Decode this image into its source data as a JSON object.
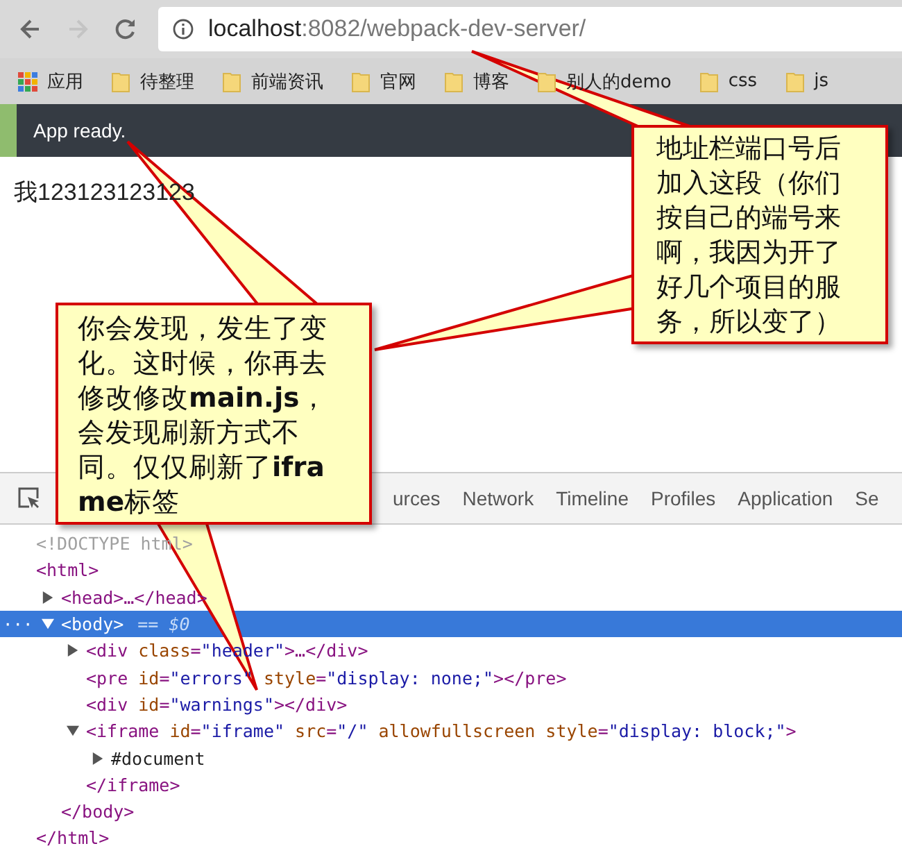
{
  "browser": {
    "address_host": "localhost",
    "address_path": ":8082/webpack-dev-server/",
    "forward_disabled": true
  },
  "bookmarks": [
    {
      "kind": "apps",
      "label": "应用"
    },
    {
      "kind": "folder",
      "label": "待整理"
    },
    {
      "kind": "folder",
      "label": "前端资讯"
    },
    {
      "kind": "folder",
      "label": "官网"
    },
    {
      "kind": "folder",
      "label": "博客"
    },
    {
      "kind": "folder",
      "label": "别人的demo"
    },
    {
      "kind": "folder",
      "label": "css"
    },
    {
      "kind": "folder",
      "label": "js"
    }
  ],
  "page": {
    "status": "App ready.",
    "content": "我123123123123"
  },
  "devtools": {
    "tabs": [
      {
        "label": "urces",
        "selected": false
      },
      {
        "label": "Network",
        "selected": false
      },
      {
        "label": "Timeline",
        "selected": false
      },
      {
        "label": "Profiles",
        "selected": false
      },
      {
        "label": "Application",
        "selected": false
      },
      {
        "label": "Se",
        "selected": false
      }
    ],
    "elements": [
      {
        "line": "<!DOCTYPE html>",
        "kind": "doctype",
        "selected": false
      },
      {
        "line": "<html>",
        "close": "</html>",
        "kind": "element",
        "selected": false,
        "children": [
          {
            "line": "<head>…</head>",
            "kind": "element",
            "expanded": false,
            "selected": false
          },
          {
            "line": "<body>",
            "suffix": "== $0",
            "dots": "···",
            "close": "</body>",
            "kind": "element",
            "expanded": true,
            "selected": true,
            "children": [
              {
                "line": "<div class=\"header\">…</div>",
                "kind": "element",
                "expanded": false,
                "selected": false
              },
              {
                "line": "<pre id=\"errors\" style=\"display: none;\"></pre>",
                "kind": "element",
                "selected": false
              },
              {
                "line": "<div id=\"warnings\"></div>",
                "kind": "element",
                "selected": false
              },
              {
                "line": "<iframe id=\"iframe\" src=\"/\" allowfullscreen style=\"display: block;\">",
                "close": "</iframe>",
                "kind": "element",
                "expanded": true,
                "selected": false,
                "children": [
                  {
                    "line": "#document",
                    "kind": "text",
                    "expanded": false,
                    "selected": false
                  }
                ]
              }
            ]
          }
        ]
      }
    ]
  },
  "callouts": [
    {
      "text": "地址栏端口号后加入这段（你们按自己的端号来啊，我因为开了好几个项目的服务，所以变了）"
    },
    {
      "text": "你会发现，发生了变化。这时候，你再去修改修改**main.js**，会发现刷新方式不同。仅仅刷新了**iframe**标签"
    }
  ]
}
